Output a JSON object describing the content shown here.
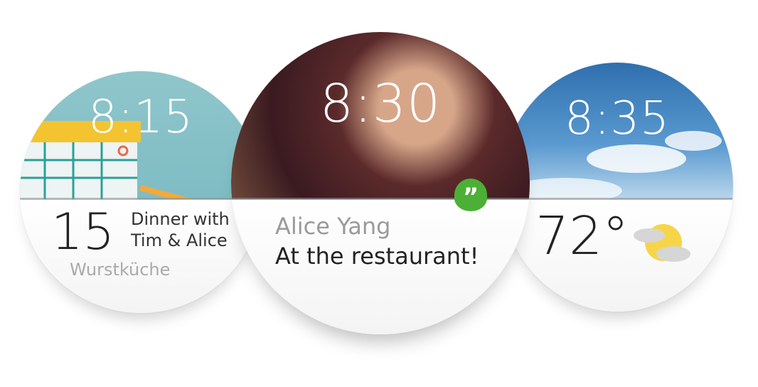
{
  "watches": [
    {
      "time": "8:15",
      "day": "15",
      "event_line1": "Dinner with",
      "event_line2": "Tim & Alice",
      "location": "Wurstküche",
      "icon": "calendar-illustration"
    },
    {
      "time": "8:30",
      "sender": "Alice Yang",
      "message": "At the restaurant!",
      "app_icon": "hangouts-quote-icon",
      "accent": "#4caf36"
    },
    {
      "time": "8:35",
      "temperature": "72°",
      "weather_icon": "partly-cloudy-icon",
      "sun_color": "#f7d548"
    }
  ]
}
